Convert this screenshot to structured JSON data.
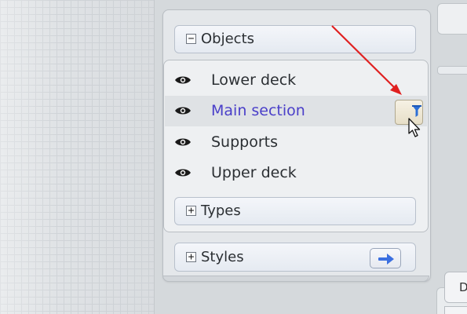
{
  "accent": "#4a3fc9",
  "annotation_arrow_color": "#e02020",
  "sections": {
    "objects": {
      "toggle": "−",
      "label": "Objects"
    },
    "types": {
      "toggle": "+",
      "label": "Types"
    },
    "styles": {
      "toggle": "+",
      "label": "Styles"
    }
  },
  "objects_list": [
    {
      "label": "Lower deck",
      "icon": "eye-icon"
    },
    {
      "label": "Main section",
      "icon": "eye-icon",
      "state": "hover"
    },
    {
      "label": "Supports",
      "icon": "eye-icon"
    },
    {
      "label": "Upper deck",
      "icon": "eye-icon"
    }
  ],
  "filter_button": {
    "icon": "filter-icon"
  },
  "styles_go_button": {
    "icon": "arrow-right-icon"
  },
  "right_tab": {
    "label": "D"
  }
}
